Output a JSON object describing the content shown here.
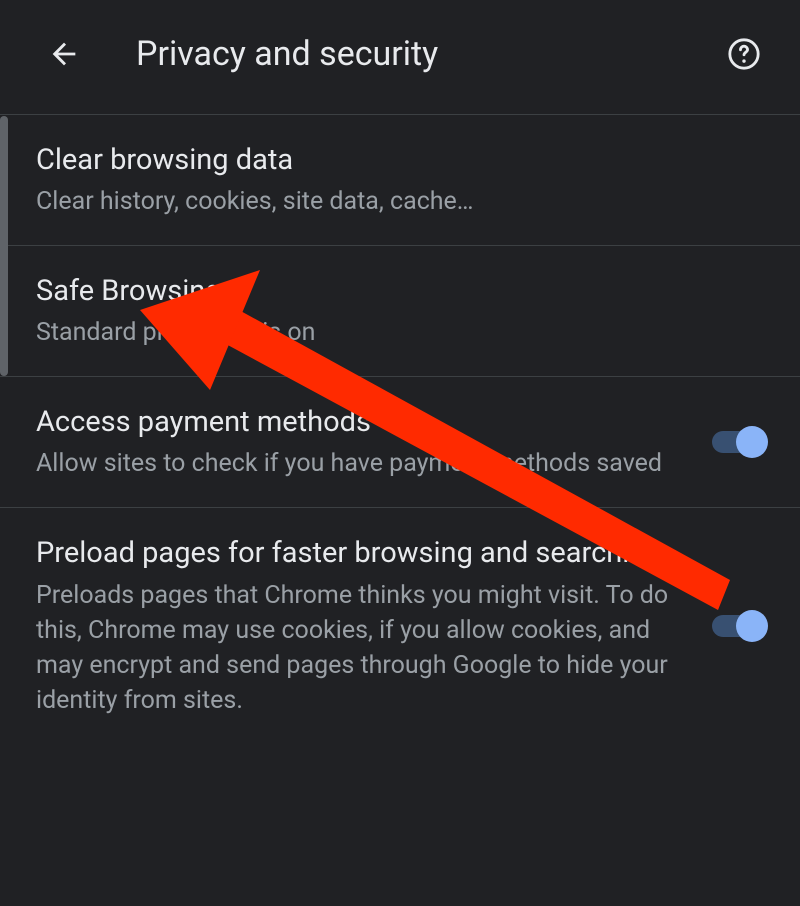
{
  "header": {
    "title": "Privacy and security"
  },
  "items": [
    {
      "title": "Clear browsing data",
      "subtitle": "Clear history, cookies, site data, cache…"
    },
    {
      "title": "Safe Browsing",
      "subtitle": "Standard protection is on"
    },
    {
      "title": "Access payment methods",
      "subtitle": "Allow sites to check if you have payment methods saved"
    },
    {
      "title": "Preload pages for faster browsing and searching",
      "subtitle": "Preloads pages that Chrome thinks you might visit. To do this, Chrome may use cookies, if you allow cookies, and may encrypt and send pages through Google to hide your identity from sites."
    }
  ]
}
